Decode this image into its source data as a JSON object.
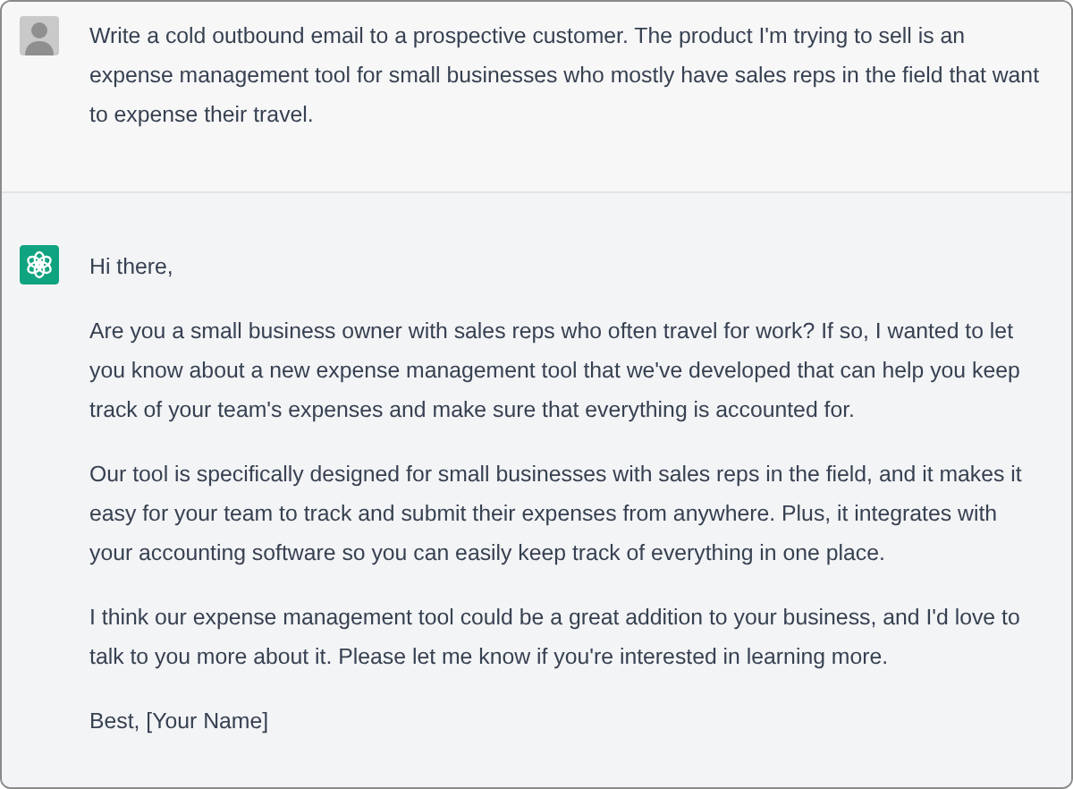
{
  "messages": [
    {
      "kind": "user",
      "paragraphs": [
        "Write a cold outbound email to a prospective customer. The product I'm trying to sell is an expense management tool for small businesses who mostly have sales reps in the field that want to expense their travel."
      ]
    },
    {
      "kind": "assistant",
      "paragraphs": [
        "Hi there,",
        "Are you a small business owner with sales reps who often travel for work? If so, I wanted to let you know about a new expense management tool that we've developed that can help you keep track of your team's expenses and make sure that everything is accounted for.",
        "Our tool is specifically designed for small businesses with sales reps in the field, and it makes it easy for your team to track and submit their expenses from anywhere. Plus, it integrates with your accounting software so you can easily keep track of everything in one place.",
        "I think our expense management tool could be a great addition to your business, and I'd love to talk to you more about it. Please let me know if you're interested in learning more.",
        "Best, [Your Name]"
      ]
    }
  ]
}
